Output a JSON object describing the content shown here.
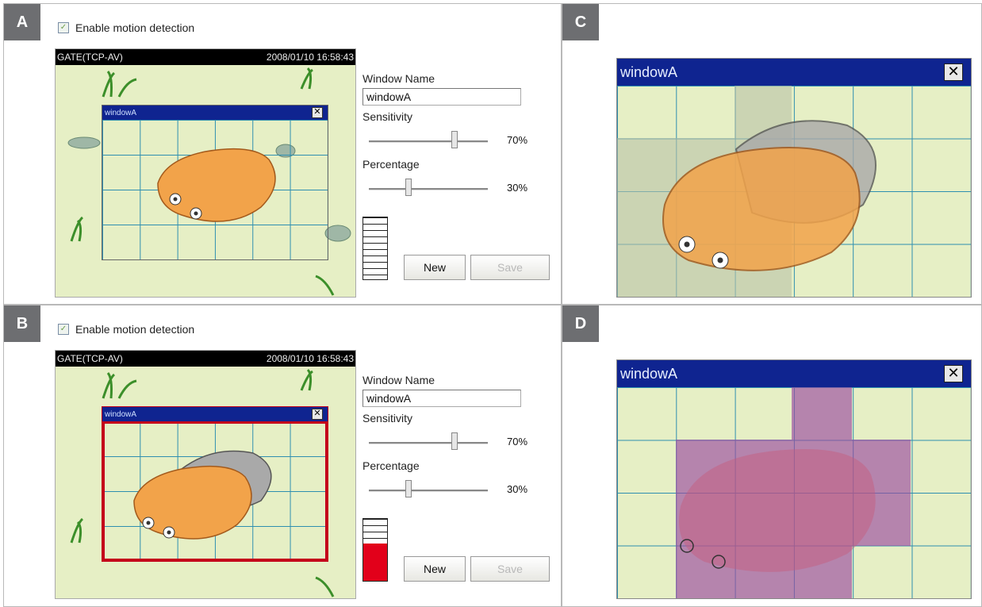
{
  "panels": {
    "a": {
      "label": "A"
    },
    "b": {
      "label": "B"
    },
    "c": {
      "label": "C"
    },
    "d": {
      "label": "D"
    }
  },
  "motion": {
    "enable_label": "Enable motion detection",
    "enabled": true,
    "camera_name": "GATE(TCP-AV)",
    "timestamp": "2008/01/10 16:58:43",
    "window_title": "windowA",
    "window_name_label": "Window Name",
    "window_name_value": "windowA",
    "sensitivity_label": "Sensitivity",
    "sensitivity_value": "70%",
    "percentage_label": "Percentage",
    "percentage_value": "30%",
    "new_label": "New",
    "save_label": "Save"
  },
  "meter_b_level_percent": 60,
  "colors": {
    "title_bar": "#0f2490",
    "alert": "#e2001a",
    "grid": "#2f8fb0",
    "background": "#e6efc5",
    "highlight": "#9b4aa0"
  }
}
